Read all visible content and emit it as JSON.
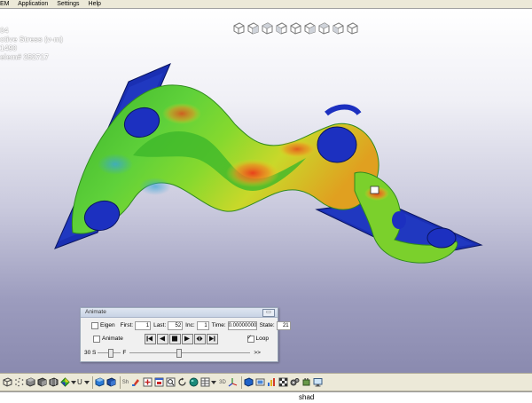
{
  "menu": [
    "EM",
    "Application",
    "Settings",
    "Help"
  ],
  "overlay": {
    "line1": "04",
    "line2": "ctive Stress (v-m)",
    "line3": "1490",
    "line4": "elem# 252717"
  },
  "view_cubes": [
    "view-iso-1",
    "view-iso-2",
    "view-iso-3",
    "view-iso-4",
    "view-iso-5",
    "view-iso-6",
    "view-iso-7",
    "view-iso-8",
    "view-iso-9"
  ],
  "animate_dialog": {
    "title": "Animate",
    "eigen_label": "Eigen",
    "eigen_checked": false,
    "first_label": "First:",
    "first_value": "1",
    "last_label": "Last:",
    "last_value": "52",
    "inc_label": "Inc:",
    "inc_value": "1",
    "time_label": "Time:",
    "time_value": "0.00000000",
    "state_label": "State:",
    "state_value": "21",
    "animate_label": "Animate",
    "animate_checked": false,
    "loop_label": "Loop",
    "loop_checked": true,
    "speed_left": "30 S",
    "speed_right": "F",
    "state_slider_end": ">>",
    "speed_slider_level": 0.55,
    "state_slider_level": 0.4
  },
  "toolbar": {
    "text_sh": "Sh",
    "text_u": "U",
    "text_3d": "3D"
  },
  "command_line": {
    "text": "shad"
  },
  "colors": {
    "viewport_top": "#ffffff",
    "viewport_bottom": "#8a8aaf",
    "mesh_green": "#4cc22e",
    "mesh_blue": "#1a2fb3",
    "mesh_red": "#e23c1a",
    "mesh_yellow": "#d8e21e"
  }
}
